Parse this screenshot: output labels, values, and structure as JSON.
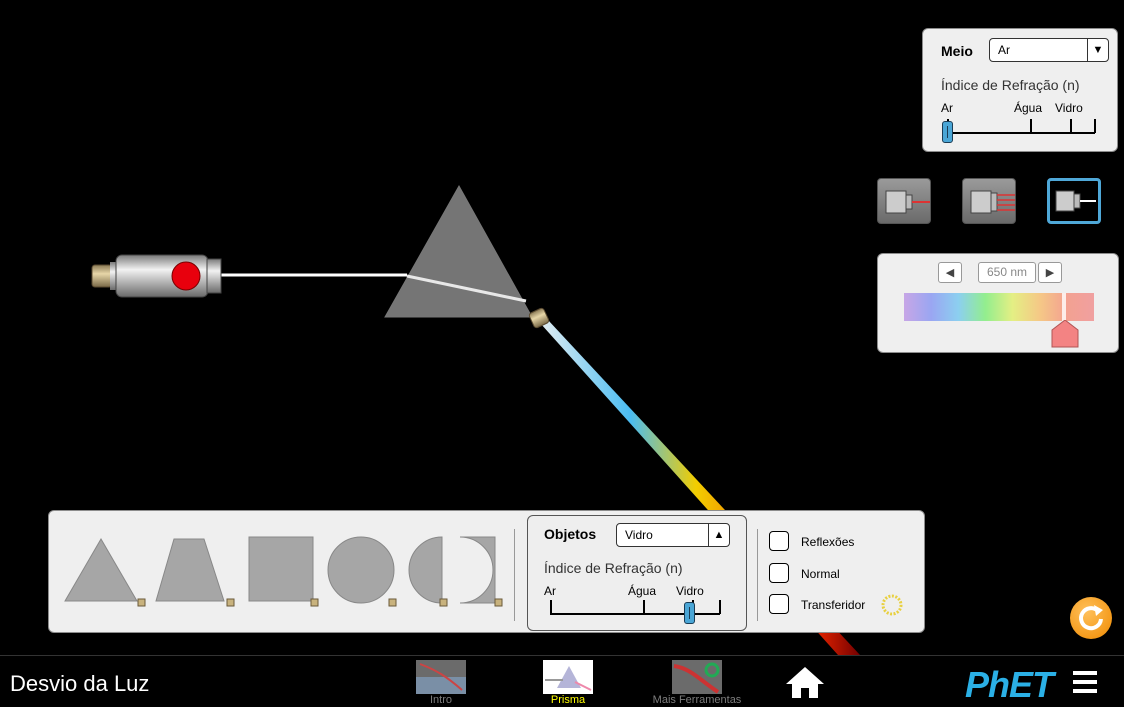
{
  "scene": {
    "colors": {
      "background": "#000000",
      "laser_beam": "#ffffff",
      "prism": "#8a8a8a"
    }
  },
  "meio_panel": {
    "title": "Meio",
    "combo_value": "Ar",
    "combo_arrow": "▼",
    "index_title": "Índice de Refração (n)",
    "tick_labels": [
      "Ar",
      "Água",
      "Vidro"
    ],
    "slider_value": "Ar"
  },
  "laser_view_buttons": [
    {
      "name": "single-ray",
      "selected": false
    },
    {
      "name": "multiple-rays",
      "selected": false
    },
    {
      "name": "white-light",
      "selected": true
    }
  ],
  "wavelength": {
    "value": "650 nm",
    "left_arrow": "◀",
    "right_arrow": "▶",
    "thumb_color": "#f38383"
  },
  "toolbox": {
    "shapes": [
      "triangle-prism",
      "trapezoid-prism",
      "square-prism",
      "circle-prism",
      "lens-prism"
    ],
    "objetos_title": "Objetos",
    "objetos_value": "Vidro",
    "objetos_arrow": "▲",
    "index_title": "Índice de Refração (n)",
    "tick_labels": [
      "Ar",
      "Água",
      "Vidro"
    ],
    "slider_value": "Vidro",
    "checkboxes": [
      {
        "label": "Reflexões",
        "checked": false
      },
      {
        "label": "Normal",
        "checked": false
      },
      {
        "label": "Transferidor",
        "checked": false
      }
    ]
  },
  "navbar": {
    "app_title": "Desvio da Luz",
    "tabs": [
      {
        "label": "Intro",
        "selected": false
      },
      {
        "label": "Prisma",
        "selected": true
      },
      {
        "label": "Mais Ferramentas",
        "selected": false
      }
    ],
    "brand": "PhET",
    "colors": {
      "selected_tab": "#ffff00",
      "unselected_tab": "#7d7d7d",
      "brand": "#2bb0e6"
    }
  }
}
